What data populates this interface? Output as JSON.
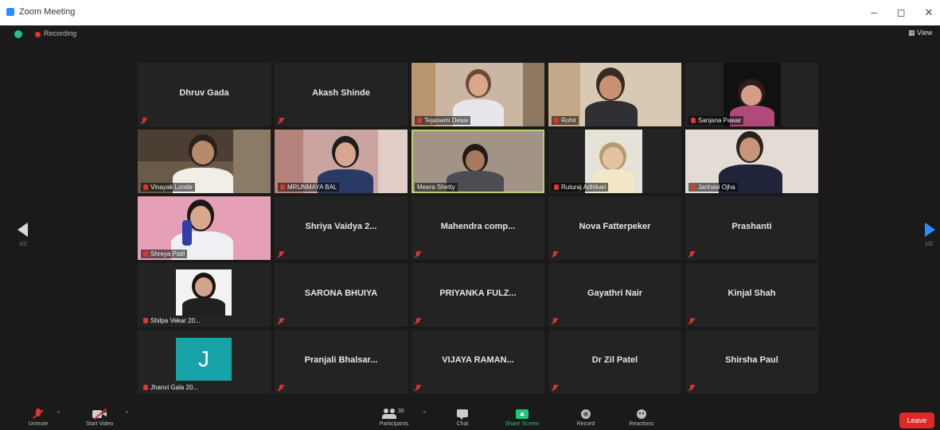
{
  "window": {
    "title": "Zoom Meeting",
    "minimize": "–",
    "restore": "◻",
    "close": "✕"
  },
  "status": {
    "recording_label": "Recording",
    "view_label": "View"
  },
  "navigation": {
    "prev_icon": "chevron-left-icon",
    "next_icon": "chevron-right-icon",
    "prev_page": "1/2",
    "next_page": "1/2"
  },
  "participants": [
    {
      "name": "Dhruv Gada",
      "video": false
    },
    {
      "name": "Akash Shinde",
      "video": false
    },
    {
      "name": "Tejaswini Desai",
      "video": true
    },
    {
      "name": "Rohit",
      "video": true
    },
    {
      "name": "Sanjana Pawar",
      "video": true
    },
    {
      "name": "Vinayak Londe",
      "video": true
    },
    {
      "name": "MRUNMAYA BAL",
      "video": true
    },
    {
      "name": "Meera Shetty",
      "video": true,
      "active": true
    },
    {
      "name": "Ruturaj Adhikari",
      "video": true
    },
    {
      "name": "Janhavi Ojha",
      "video": true
    },
    {
      "name": "Shreya Patil",
      "video": true
    },
    {
      "name": "Shriya Vaidya 2...",
      "video": false
    },
    {
      "name": "Mahendra comp...",
      "video": false
    },
    {
      "name": "Nova Fatterpeker",
      "video": false
    },
    {
      "name": "Prashanti",
      "video": false
    },
    {
      "name": "Shilpa Vekar 20...",
      "video": true
    },
    {
      "name": "SARONA BHUIYA",
      "video": false
    },
    {
      "name": "PRIYANKA FULZ...",
      "video": false
    },
    {
      "name": "Gayathri Nair",
      "video": false
    },
    {
      "name": "Kinjal Shah",
      "video": false
    },
    {
      "name": "Jhanvi Gala 20...",
      "video": false,
      "avatar_letter": "J"
    },
    {
      "name": "Pranjali Bhalsar...",
      "video": false
    },
    {
      "name": "VIJAYA RAMAN...",
      "video": false
    },
    {
      "name": "Dr Zil Patel",
      "video": false
    },
    {
      "name": "Shirsha Paul",
      "video": false
    }
  ],
  "toolbar": {
    "unmute": "Unmute",
    "start_video": "Start Video",
    "participants": "Participants",
    "participants_count": "30",
    "chat": "Chat",
    "share_screen": "Share Screen",
    "record": "Record",
    "reactions": "Reactions",
    "leave": "Leave"
  },
  "colors": {
    "accent": "#2d8cff",
    "share_green": "#26c281",
    "leave_red": "#e02828",
    "active_speaker": "#b6d36b"
  }
}
